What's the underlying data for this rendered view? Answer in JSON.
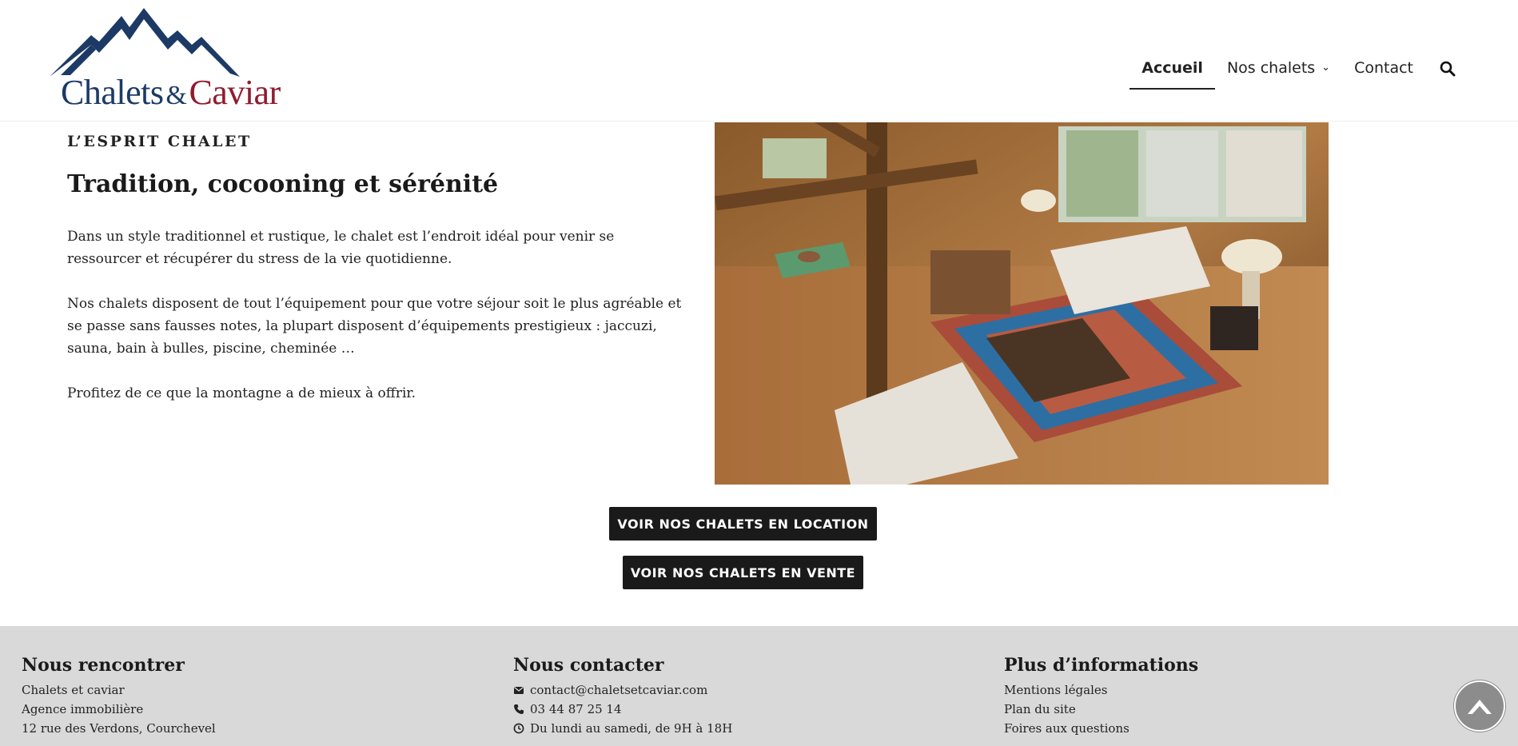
{
  "brand": {
    "logo_word1": "Chalets",
    "logo_amp": "&",
    "logo_word2": "Caviar",
    "color_navy": "#1d3a66",
    "color_burgundy": "#8e1c2e"
  },
  "nav": {
    "items": [
      {
        "label": "Accueil",
        "active": true
      },
      {
        "label": "Nos chalets",
        "has_dropdown": true
      },
      {
        "label": "Contact"
      }
    ],
    "search_icon": "search-icon"
  },
  "section": {
    "kicker": "L’ESPRIT CHALET",
    "title": "Tradition, cocooning et sérénité",
    "paragraphs": [
      "Dans un style traditionnel et rustique, le chalet est l’endroit idéal pour venir se ressourcer et récupérer du stress de la vie quotidienne.",
      "Nos chalets disposent de tout l’équipement pour que votre séjour soit le plus agréable et se passe sans fausses notes, la plupart disposent d’équipements prestigieux : jaccuzi, sauna, bain à bulles, piscine, cheminée …",
      "Profitez de ce que la montagne a de mieux à offrir."
    ]
  },
  "buttons": {
    "location": "VOIR NOS CHALETS EN LOCATION",
    "vente": "VOIR NOS CHALETS EN VENTE"
  },
  "footer": {
    "col1": {
      "title": "Nous rencontrer",
      "lines": [
        "Chalets et caviar",
        "Agence immobilière",
        "12 rue des Verdons, Courchevel"
      ]
    },
    "col2": {
      "title": "Nous contacter",
      "email": "contact@chaletsetcaviar.com",
      "phone": "03 44 87 25 14",
      "hours": "Du lundi au samedi, de 9H à 18H"
    },
    "col3": {
      "title": "Plus d’informations",
      "links": [
        "Mentions légales",
        "Plan du site",
        "Foires aux questions"
      ]
    }
  },
  "icons": {
    "email": "envelope-icon",
    "phone": "phone-icon",
    "hours": "clock-icon",
    "scroll": "chevron-up-icon"
  }
}
